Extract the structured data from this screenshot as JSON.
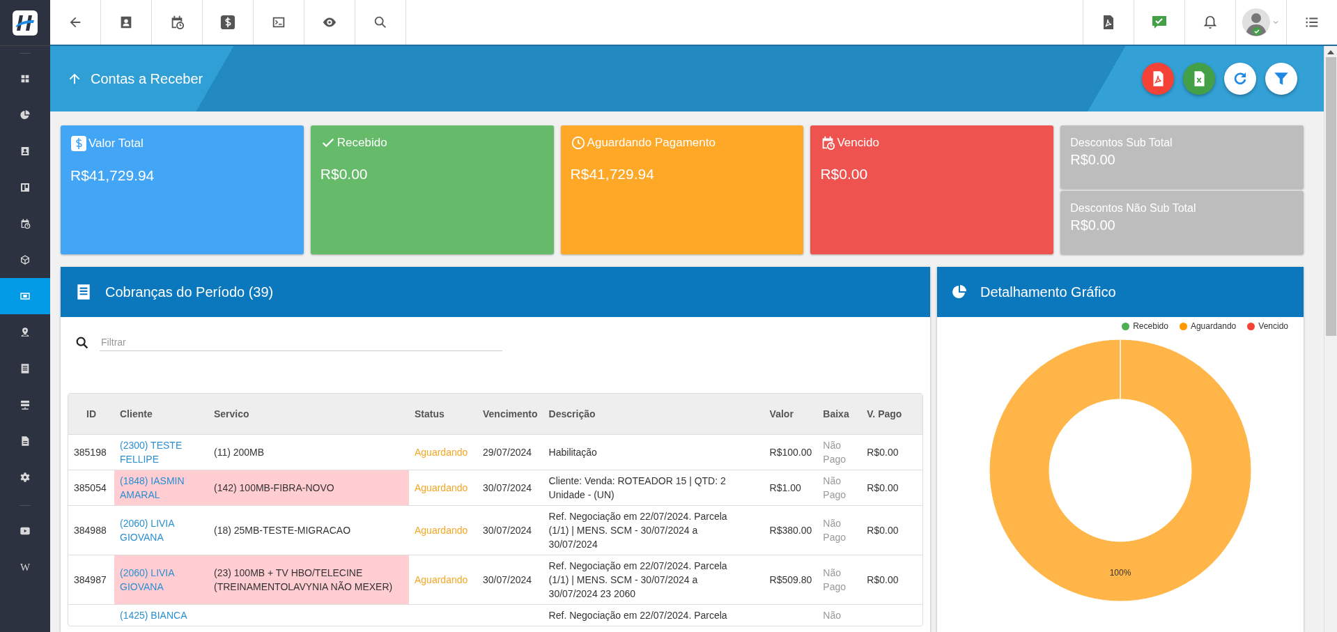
{
  "sidebar": {
    "items": [
      {
        "selected": false
      },
      {
        "selected": false
      },
      {
        "selected": false
      },
      {
        "selected": false
      },
      {
        "selected": false
      },
      {
        "selected": false
      },
      {
        "selected": true
      },
      {
        "selected": false
      },
      {
        "selected": false
      },
      {
        "selected": false
      },
      {
        "selected": false
      },
      {
        "selected": false
      }
    ],
    "footer_items": [
      {
        "kind": "video"
      },
      {
        "kind": "wiki",
        "label": "W"
      }
    ]
  },
  "header": {
    "title": "Contas a Receber",
    "actions": [
      {
        "kind": "pdf"
      },
      {
        "kind": "excel"
      },
      {
        "kind": "refresh"
      },
      {
        "kind": "filter"
      }
    ]
  },
  "cards": [
    {
      "kind": "total",
      "label": "Valor Total",
      "value": "R$41,729.94",
      "color": "#42a5f5"
    },
    {
      "kind": "received",
      "label": "Recebido",
      "value": "R$0.00",
      "color": "#66bb6a"
    },
    {
      "kind": "pending",
      "label": "Aguardando Pagamento",
      "value": "R$41,729.94",
      "color": "#ffa726"
    },
    {
      "kind": "overdue",
      "label": "Vencido",
      "value": "R$0.00",
      "color": "#ef5350"
    }
  ],
  "discounts": [
    {
      "label": "Descontos Sub Total",
      "value": "R$0.00"
    },
    {
      "label": "Descontos Não Sub Total",
      "value": "R$0.00"
    }
  ],
  "charges": {
    "title": "Cobranças do Período (39)",
    "filter": {
      "placeholder": "Filtrar"
    },
    "columns": [
      "ID",
      "Cliente",
      "Servico",
      "Status",
      "Vencimento",
      "Descrição",
      "Valor",
      "Baixa",
      "V. Pago"
    ],
    "rows": [
      {
        "id": "385198",
        "client": "(2300) TESTE FELLIPE",
        "service": "(11) 200MB",
        "status": "Aguardando",
        "due": "29/07/2024",
        "description": "Habilitação",
        "value": "R$100.00",
        "settled": "Não Pago",
        "paid": "R$0.00",
        "highlight": false
      },
      {
        "id": "385054",
        "client": "(1848) IASMIN AMARAL",
        "service": "(142) 100MB-FIBRA-NOVO",
        "status": "Aguardando",
        "due": "30/07/2024",
        "description": "Cliente: Venda: ROTEADOR 15 | QTD: 2 Unidade - (UN)",
        "value": "R$1.00",
        "settled": "Não Pago",
        "paid": "R$0.00",
        "highlight": true
      },
      {
        "id": "384988",
        "client": "(2060) LIVIA GIOVANA",
        "service": "(18) 25MB-TESTE-MIGRACAO",
        "status": "Aguardando",
        "due": "30/07/2024",
        "description": "Ref. Negociação em 22/07/2024. Parcela (1/1) | MENS. SCM - 30/07/2024 a 30/07/2024",
        "value": "R$380.00",
        "settled": "Não Pago",
        "paid": "R$0.00",
        "highlight": false
      },
      {
        "id": "384987",
        "client": "(2060) LIVIA GIOVANA",
        "service": "(23) 100MB + TV HBO/TELECINE (TREINAMENTOLAVYNIA NÃO MEXER)",
        "status": "Aguardando",
        "due": "30/07/2024",
        "description": "Ref. Negociação em 22/07/2024. Parcela (1/1) | MENS. SCM - 30/07/2024 a 30/07/2024 23 2060",
        "value": "R$509.80",
        "settled": "Não Pago",
        "paid": "R$0.00",
        "highlight": true
      },
      {
        "client": "(1425) BIANCA",
        "description": "Ref. Negociação em 22/07/2024. Parcela",
        "settled": "Não",
        "highlight": false
      }
    ]
  },
  "chart_panel": {
    "title": "Detalhamento Gráfico",
    "chart_data": {
      "type": "donut",
      "categories": [
        "Recebido",
        "Aguardando",
        "Vencido"
      ],
      "series": [
        {
          "values": [
            0,
            100,
            0
          ]
        }
      ],
      "colors": [
        "#4caf50",
        "#ff9800",
        "#f44336"
      ],
      "value_labels": [
        null,
        "100%",
        null
      ]
    }
  }
}
